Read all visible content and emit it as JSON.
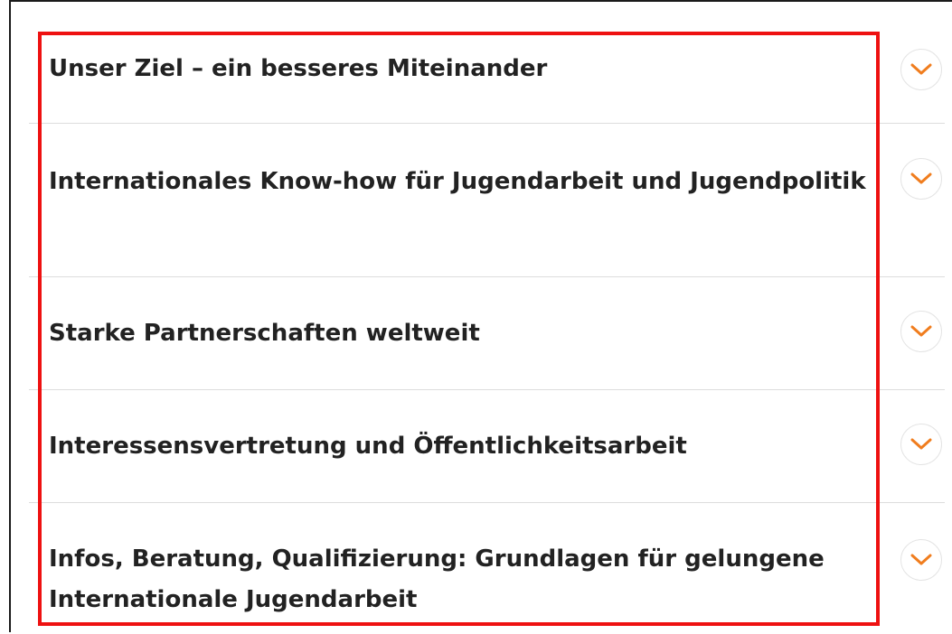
{
  "accordion": {
    "items": [
      {
        "title": "Unser Ziel – ein besseres Miteinander",
        "icon": "chevron-down-icon"
      },
      {
        "title": "Internationales Know-how für Jugendarbeit und Jugendpolitik",
        "icon": "chevron-down-icon"
      },
      {
        "title": "Starke Partnerschaften weltweit",
        "icon": "chevron-down-icon"
      },
      {
        "title": "Interessensvertretung und Öffentlichkeitsarbeit",
        "icon": "chevron-down-icon"
      },
      {
        "title": "Infos, Beratung, Qualifizierung: Grundlagen für gelungene Internationale Jugendarbeit",
        "icon": "chevron-down-icon"
      }
    ]
  },
  "colors": {
    "chevron": "#f07d1e",
    "highlight_border": "#ee1111",
    "title_text": "#222222",
    "divider": "#dddddd"
  }
}
